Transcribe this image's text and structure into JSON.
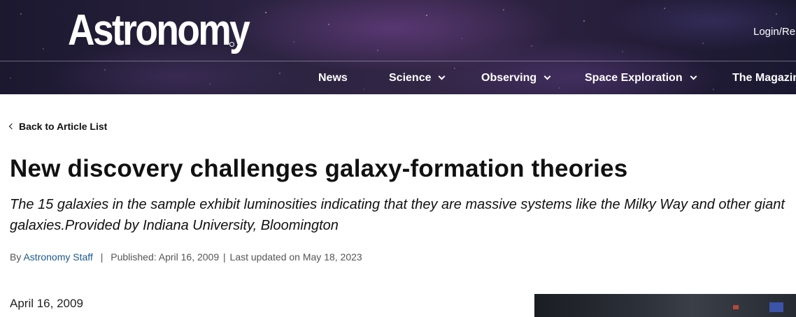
{
  "header": {
    "logo_text": "Astronomy",
    "login_text": "Login/Re",
    "nav": [
      {
        "label": "News",
        "has_dropdown": false
      },
      {
        "label": "Science",
        "has_dropdown": true
      },
      {
        "label": "Observing",
        "has_dropdown": true
      },
      {
        "label": "Space Exploration",
        "has_dropdown": true
      },
      {
        "label": "The Magazin",
        "has_dropdown": false
      }
    ]
  },
  "article": {
    "back_link": "Back to Article List",
    "title": "New discovery challenges galaxy-formation theories",
    "subtitle": "The 15 galaxies in the sample exhibit luminosities indicating that they are massive systems like the Milky Way and other giant galaxies.Provided by Indiana University, Bloomington",
    "byline": {
      "by": "By",
      "author": "Astronomy Staff",
      "published": "Published: April 16, 2009",
      "updated": "Last updated on May 18, 2023"
    },
    "dateline": "April 16, 2009"
  },
  "colors": {
    "author_link": "#1a5a8e",
    "header_bg": "#2b2340"
  }
}
